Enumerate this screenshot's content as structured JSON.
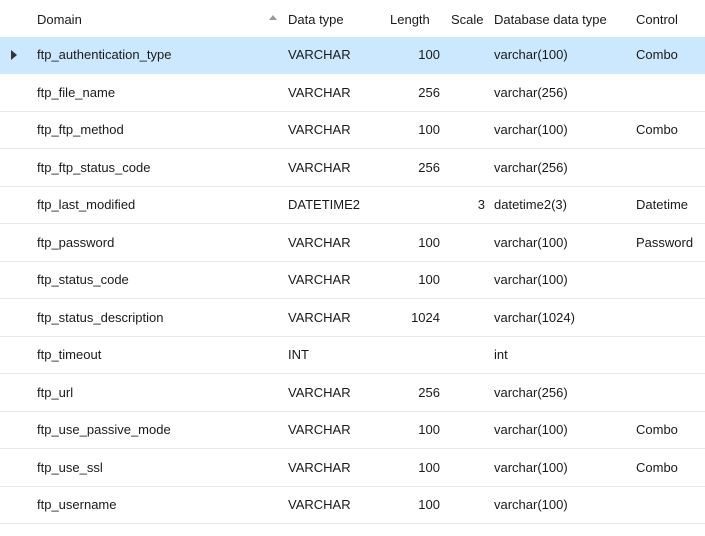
{
  "columns": {
    "domain": "Domain",
    "data_type": "Data type",
    "length": "Length",
    "scale": "Scale",
    "db_data_type": "Database data type",
    "control": "Control"
  },
  "sort": {
    "column": "domain",
    "direction": "ascending",
    "icon": "sort-ascending-icon"
  },
  "selected_row": 0,
  "colors": {
    "selected_row_bg": "#cce8ff",
    "row_divider": "#e8e8e8"
  },
  "rows": [
    {
      "domain": "ftp_authentication_type",
      "data_type": "VARCHAR",
      "length": "100",
      "scale": "",
      "db_type": "varchar(100)",
      "control": "Combo"
    },
    {
      "domain": "ftp_file_name",
      "data_type": "VARCHAR",
      "length": "256",
      "scale": "",
      "db_type": "varchar(256)",
      "control": ""
    },
    {
      "domain": "ftp_ftp_method",
      "data_type": "VARCHAR",
      "length": "100",
      "scale": "",
      "db_type": "varchar(100)",
      "control": "Combo"
    },
    {
      "domain": "ftp_ftp_status_code",
      "data_type": "VARCHAR",
      "length": "256",
      "scale": "",
      "db_type": "varchar(256)",
      "control": ""
    },
    {
      "domain": "ftp_last_modified",
      "data_type": "DATETIME2",
      "length": "",
      "scale": "3",
      "db_type": "datetime2(3)",
      "control": "Datetime"
    },
    {
      "domain": "ftp_password",
      "data_type": "VARCHAR",
      "length": "100",
      "scale": "",
      "db_type": "varchar(100)",
      "control": "Password"
    },
    {
      "domain": "ftp_status_code",
      "data_type": "VARCHAR",
      "length": "100",
      "scale": "",
      "db_type": "varchar(100)",
      "control": ""
    },
    {
      "domain": "ftp_status_description",
      "data_type": "VARCHAR",
      "length": "1024",
      "scale": "",
      "db_type": "varchar(1024)",
      "control": ""
    },
    {
      "domain": "ftp_timeout",
      "data_type": "INT",
      "length": "",
      "scale": "",
      "db_type": "int",
      "control": ""
    },
    {
      "domain": "ftp_url",
      "data_type": "VARCHAR",
      "length": "256",
      "scale": "",
      "db_type": "varchar(256)",
      "control": ""
    },
    {
      "domain": "ftp_use_passive_mode",
      "data_type": "VARCHAR",
      "length": "100",
      "scale": "",
      "db_type": "varchar(100)",
      "control": "Combo"
    },
    {
      "domain": "ftp_use_ssl",
      "data_type": "VARCHAR",
      "length": "100",
      "scale": "",
      "db_type": "varchar(100)",
      "control": "Combo"
    },
    {
      "domain": "ftp_username",
      "data_type": "VARCHAR",
      "length": "100",
      "scale": "",
      "db_type": "varchar(100)",
      "control": ""
    }
  ]
}
